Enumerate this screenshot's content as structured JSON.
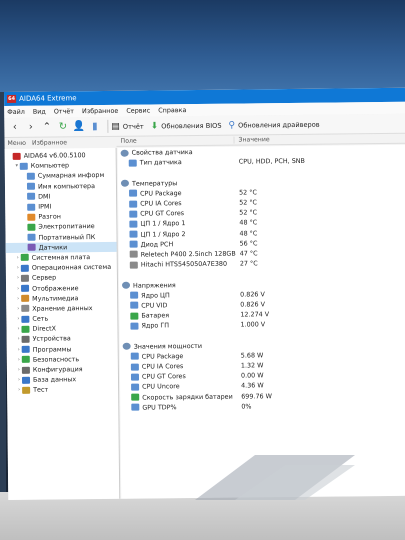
{
  "window_title": "AIDA64 Extreme",
  "app_icon_text": "64",
  "menu": [
    "Файл",
    "Вид",
    "Отчёт",
    "Избранное",
    "Сервис",
    "Справка"
  ],
  "toolbar": {
    "report_label": "Отчёт",
    "bios_update_label": "Обновления BIOS",
    "driver_update_label": "Обновления драйверов"
  },
  "left_tabs": [
    "Меню",
    "Избранное"
  ],
  "columns": {
    "field": "Поле",
    "value": "Значение"
  },
  "tree": [
    {
      "label": "AIDA64 v6.00.5100",
      "level": 0,
      "icon_color": "#c62828",
      "arrow": ""
    },
    {
      "label": "Компьютер",
      "level": 1,
      "icon_color": "#5b8fd1",
      "arrow": "▾"
    },
    {
      "label": "Суммарная информ",
      "level": 2,
      "icon_color": "#5b8fd1",
      "arrow": ""
    },
    {
      "label": "Имя компьютера",
      "level": 2,
      "icon_color": "#5b8fd1",
      "arrow": ""
    },
    {
      "label": "DMI",
      "level": 2,
      "icon_color": "#5b8fd1",
      "arrow": ""
    },
    {
      "label": "IPMI",
      "level": 2,
      "icon_color": "#5b8fd1",
      "arrow": ""
    },
    {
      "label": "Разгон",
      "level": 2,
      "icon_color": "#e08a2b",
      "arrow": ""
    },
    {
      "label": "Электропитание",
      "level": 2,
      "icon_color": "#3aa64a",
      "arrow": ""
    },
    {
      "label": "Портативный ПК",
      "level": 2,
      "icon_color": "#5b8fd1",
      "arrow": ""
    },
    {
      "label": "Датчики",
      "level": 2,
      "icon_color": "#7b5bb5",
      "arrow": "",
      "selected": true
    },
    {
      "label": "Системная плата",
      "level": 1,
      "icon_color": "#3aa64a",
      "arrow": "›"
    },
    {
      "label": "Операционная система",
      "level": 1,
      "icon_color": "#3b78c9",
      "arrow": "›"
    },
    {
      "label": "Сервер",
      "level": 1,
      "icon_color": "#7a7a7a",
      "arrow": "›"
    },
    {
      "label": "Отображение",
      "level": 1,
      "icon_color": "#3b78c9",
      "arrow": "›"
    },
    {
      "label": "Мультимедиа",
      "level": 1,
      "icon_color": "#d08b2c",
      "arrow": "›"
    },
    {
      "label": "Хранение данных",
      "level": 1,
      "icon_color": "#8a8a8a",
      "arrow": "›"
    },
    {
      "label": "Сеть",
      "level": 1,
      "icon_color": "#3b78c9",
      "arrow": "›"
    },
    {
      "label": "DirectX",
      "level": 1,
      "icon_color": "#3aa64a",
      "arrow": "›"
    },
    {
      "label": "Устройства",
      "level": 1,
      "icon_color": "#6b6b6b",
      "arrow": "›"
    },
    {
      "label": "Программы",
      "level": 1,
      "icon_color": "#3b78c9",
      "arrow": "›"
    },
    {
      "label": "Безопасность",
      "level": 1,
      "icon_color": "#3aa64a",
      "arrow": "›"
    },
    {
      "label": "Конфигурация",
      "level": 1,
      "icon_color": "#6b6b6b",
      "arrow": "›"
    },
    {
      "label": "База данных",
      "level": 1,
      "icon_color": "#3b78c9",
      "arrow": "›"
    },
    {
      "label": "Тест",
      "level": 1,
      "icon_color": "#c29a2c",
      "arrow": "›"
    }
  ],
  "sections": [
    {
      "title": "Свойства датчика",
      "icon": "sensor-icon",
      "rows": [
        {
          "field": "Тип датчика",
          "value": "CPU, HDD, PCH, SNB",
          "icon_color": "#5b8fd1"
        }
      ]
    },
    {
      "title": "Температуры",
      "icon": "thermometer-icon",
      "rows": [
        {
          "field": "CPU Package",
          "value": "52 °C",
          "icon_color": "#5b8fd1"
        },
        {
          "field": "CPU IA Cores",
          "value": "52 °C",
          "icon_color": "#5b8fd1"
        },
        {
          "field": "CPU GT Cores",
          "value": "52 °C",
          "icon_color": "#5b8fd1"
        },
        {
          "field": "ЦП 1 / Ядро 1",
          "value": "48 °C",
          "icon_color": "#5b8fd1"
        },
        {
          "field": "ЦП 1 / Ядро 2",
          "value": "48 °C",
          "icon_color": "#5b8fd1"
        },
        {
          "field": "Диод PCH",
          "value": "56 °C",
          "icon_color": "#5b8fd1"
        },
        {
          "field": "Reletech P400 2.5inch 128GB",
          "value": "47 °C",
          "icon_color": "#8a8a8a"
        },
        {
          "field": "Hitachi HTS545050A7E380",
          "value": "27 °C",
          "icon_color": "#8a8a8a"
        }
      ]
    },
    {
      "title": "Напряжения",
      "icon": "voltage-icon",
      "rows": [
        {
          "field": "Ядро ЦП",
          "value": "0.826 V",
          "icon_color": "#5b8fd1"
        },
        {
          "field": "CPU VID",
          "value": "0.826 V",
          "icon_color": "#5b8fd1"
        },
        {
          "field": "Батарея",
          "value": "12.274 V",
          "icon_color": "#3aa64a"
        },
        {
          "field": "Ядро ГП",
          "value": "1.000 V",
          "icon_color": "#5b8fd1"
        }
      ]
    },
    {
      "title": "Значения мощности",
      "icon": "power-icon",
      "rows": [
        {
          "field": "CPU Package",
          "value": "5.68 W",
          "icon_color": "#5b8fd1"
        },
        {
          "field": "CPU IA Cores",
          "value": "1.32 W",
          "icon_color": "#5b8fd1"
        },
        {
          "field": "CPU GT Cores",
          "value": "0.00 W",
          "icon_color": "#5b8fd1"
        },
        {
          "field": "CPU Uncore",
          "value": "4.36 W",
          "icon_color": "#5b8fd1"
        },
        {
          "field": "Скорость зарядки батареи",
          "value": "699.76 W",
          "icon_color": "#3aa64a"
        },
        {
          "field": "GPU TDP%",
          "value": "0%",
          "icon_color": "#5b8fd1"
        }
      ]
    }
  ]
}
